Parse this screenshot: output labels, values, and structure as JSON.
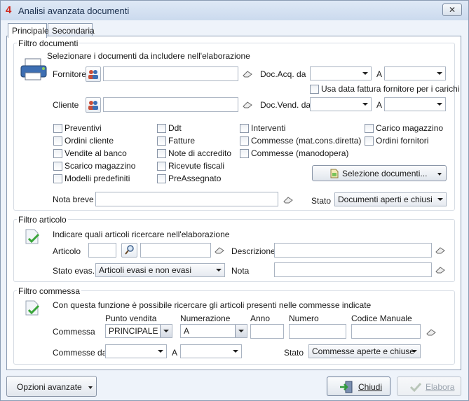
{
  "window": {
    "title": "Analisi avanzata documenti",
    "app_icon": "4",
    "close": "✕"
  },
  "tabs": [
    {
      "label": "Principale"
    },
    {
      "label": "Secondaria"
    }
  ],
  "filtro_documenti": {
    "title": "Filtro documenti",
    "instruction": "Selezionare i documenti da includere nell'elaborazione",
    "fornitore_label": "Fornitore",
    "cliente_label": "Cliente",
    "doc_acq_label": "Doc.Acq. da",
    "doc_vend_label": "Doc.Vend. da",
    "a_label": "A",
    "usa_data_label": "Usa data fattura fornitore per i carichi",
    "checkboxes": [
      "Preventivi",
      "Ordini cliente",
      "Vendite al banco",
      "Scarico magazzino",
      "Modelli predefiniti",
      "Ddt",
      "Fatture",
      "Note di accredito",
      "Ricevute fiscali",
      "PreAssegnato",
      "Interventi",
      "Commesse (mat.cons.diretta)",
      "Commesse (manodopera)",
      "Carico magazzino",
      "Ordini fornitori"
    ],
    "selezione_button": "Selezione documenti...",
    "nota_breve_label": "Nota breve",
    "stato_label": "Stato",
    "stato_value": "Documenti aperti e chiusi"
  },
  "filtro_articolo": {
    "title": "Filtro articolo",
    "instruction": "Indicare quali articoli ricercare nell'elaborazione",
    "articolo_label": "Articolo",
    "descrizione_label": "Descrizione",
    "stato_evas_label": "Stato evas.",
    "stato_evas_value": "Articoli evasi e non evasi",
    "nota_label": "Nota"
  },
  "filtro_commessa": {
    "title": "Filtro commessa",
    "instruction": "Con questa funzione è possibile ricercare gli articoli presenti nelle commesse indicate",
    "commessa_label": "Commessa",
    "punto_vendita_label": "Punto vendita",
    "punto_vendita_value": "PRINCIPALE",
    "numerazione_label": "Numerazione",
    "numerazione_value": "A",
    "anno_label": "Anno",
    "numero_label": "Numero",
    "codice_manuale_label": "Codice Manuale",
    "commesse_da_label": "Commesse  da",
    "a_label": "A",
    "stato_label": "Stato",
    "stato_value": "Commesse aperte e chiuse"
  },
  "footer": {
    "opzioni_label": "Opzioni avanzate",
    "chiudi_label": "Chiudi",
    "elabora_label": "Elabora"
  }
}
